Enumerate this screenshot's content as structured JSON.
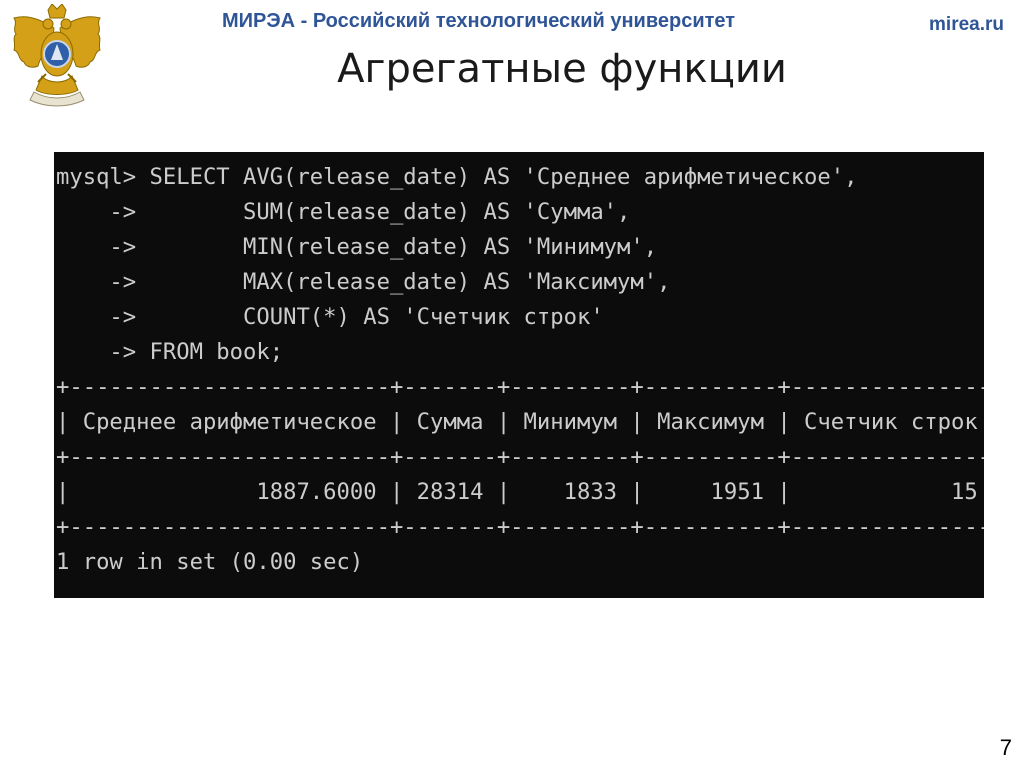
{
  "header": {
    "university": "МИРЭА - Российский технологический университет",
    "site": "mirea.ru"
  },
  "slide": {
    "title": "Агрегатные функции",
    "page_number": "7"
  },
  "terminal": {
    "lines": [
      "mysql> SELECT AVG(release_date) AS 'Среднее арифметическое',",
      "    ->        SUM(release_date) AS 'Сумма',",
      "    ->        MIN(release_date) AS 'Минимум',",
      "    ->        MAX(release_date) AS 'Максимум',",
      "    ->        COUNT(*) AS 'Счетчик строк'",
      "    -> FROM book;",
      "+------------------------+-------+---------+----------+---------------+",
      "| Среднее арифметическое | Сумма | Минимум | Максимум | Счетчик строк |",
      "+------------------------+-------+---------+----------+---------------+",
      "|              1887.6000 | 28314 |    1833 |     1951 |            15 |",
      "+------------------------+-------+---------+----------+---------------+",
      "1 row in set (0.00 sec)"
    ]
  },
  "colors": {
    "header_blue": "#2f5597",
    "terminal_bg": "#0c0c0c",
    "terminal_text": "#cccccc"
  }
}
